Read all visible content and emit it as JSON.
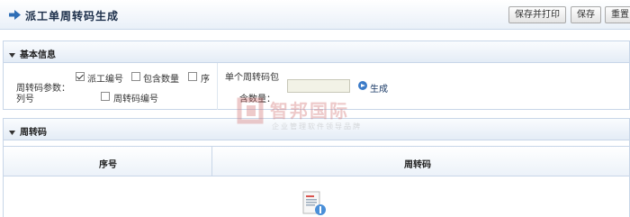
{
  "header": {
    "title": "派工单周转码生成",
    "buttons": [
      "保存并打印",
      "保存",
      "重置"
    ]
  },
  "basic_info": {
    "section_title": "基本信息",
    "param_label": "周转码参数：",
    "options": [
      {
        "label": "派工编号",
        "checked": true
      },
      {
        "label": "包含数量",
        "checked": false
      },
      {
        "label": "序",
        "checked": false
      },
      {
        "label": "周转码编号",
        "checked": false
      }
    ],
    "wrap_text": "列号",
    "qty_label_line1": "单个周转码包",
    "qty_label_line2": "含数量：",
    "qty_value": "",
    "generate_label": "生成"
  },
  "turnover_codes": {
    "section_title": "周转码",
    "columns": [
      "序号",
      "周转码"
    ]
  },
  "watermark": {
    "brand": "智邦国际",
    "tagline": "企业管理软件领导品牌"
  }
}
